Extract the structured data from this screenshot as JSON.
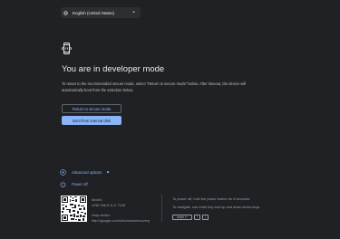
{
  "language": {
    "label": "English (United States)",
    "icon": "globe-icon"
  },
  "main": {
    "title": "You are in developer mode",
    "description": "To return to the recommended secure mode, select \"Return to secure mode\" below. After timeout, the device will automatically boot from the selection below.",
    "buttons": {
      "secure": "Return to secure mode",
      "boot": "Boot from internal disk"
    }
  },
  "menu": {
    "advanced": "Advanced options",
    "power_off": "Power off"
  },
  "device": {
    "model_label": "Model:",
    "model_value": "LINK DALE A-C 7126",
    "help_label": "Help center:",
    "help_value": "http://google.com/chromeos/recovery"
  },
  "help": {
    "line1": "To power off, hold the power button for 8 seconds.",
    "line2": "To navigate, use enter key and up and down arrow keys.",
    "keys": {
      "enter": "enter ↵",
      "up": "↑",
      "down": "↓"
    }
  },
  "colors": {
    "background": "#202124",
    "accent": "#8ab4f8",
    "text": "#e8eaed",
    "secondary": "#9aa0a6"
  }
}
